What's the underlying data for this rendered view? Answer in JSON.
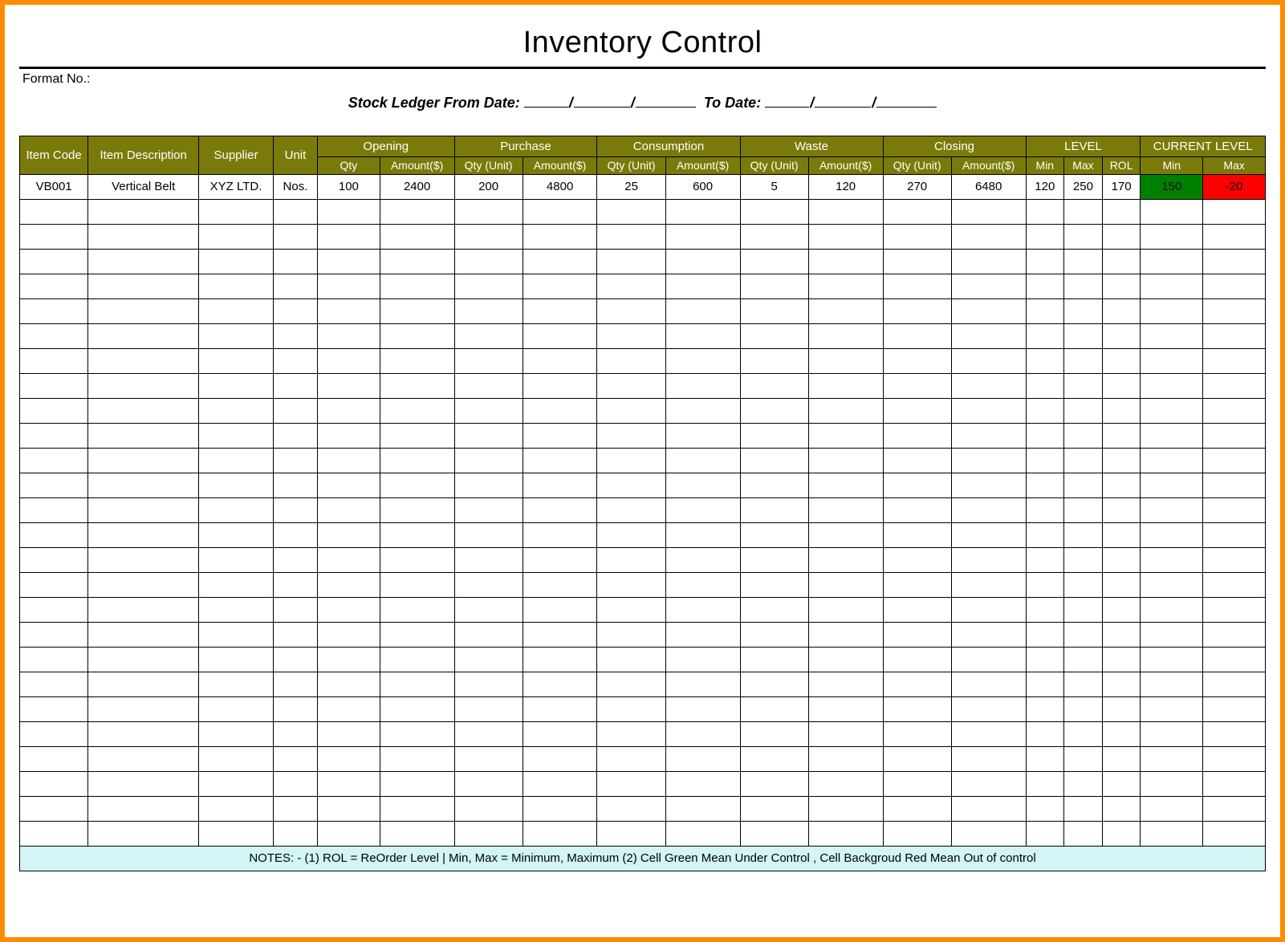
{
  "title": "Inventory Control",
  "format_label": "Format No.:",
  "daterange": {
    "prefix": "Stock Ledger From Date:",
    "to_label": "To Date:"
  },
  "headers": {
    "item_code": "Item Code",
    "item_desc": "Item Description",
    "supplier": "Supplier",
    "unit": "Unit",
    "groups": {
      "opening": "Opening",
      "purchase": "Purchase",
      "consumption": "Consumption",
      "waste": "Waste",
      "closing": "Closing",
      "level": "LEVEL",
      "current": "CURRENT LEVEL"
    },
    "sub": {
      "qty": "Qty",
      "amount": "Amount($)",
      "qty_unit": "Qty (Unit)",
      "min": "Min",
      "max": "Max",
      "rol": "ROL"
    }
  },
  "rows": [
    {
      "item_code": "VB001",
      "item_desc": "Vertical Belt",
      "supplier": "XYZ LTD.",
      "unit": "Nos.",
      "opening_qty": "100",
      "opening_amt": "2400",
      "purchase_qty": "200",
      "purchase_amt": "4800",
      "consumption_qty": "25",
      "consumption_amt": "600",
      "waste_qty": "5",
      "waste_amt": "120",
      "closing_qty": "270",
      "closing_amt": "6480",
      "level_min": "120",
      "level_max": "250",
      "level_rol": "170",
      "current_min": "150",
      "current_max": "-20"
    }
  ],
  "empty_row_count": 26,
  "notes": "NOTES: - (1) ROL = ReOrder Level | Min, Max = Minimum, Maximum     (2) Cell Green Mean Under Control , Cell Backgroud Red Mean Out of control",
  "colors": {
    "header_bg": "#7a7a0a",
    "frame_border": "#ff8c00",
    "green": "#008000",
    "red": "#ff0000",
    "notes_bg": "#d3f5f5"
  }
}
